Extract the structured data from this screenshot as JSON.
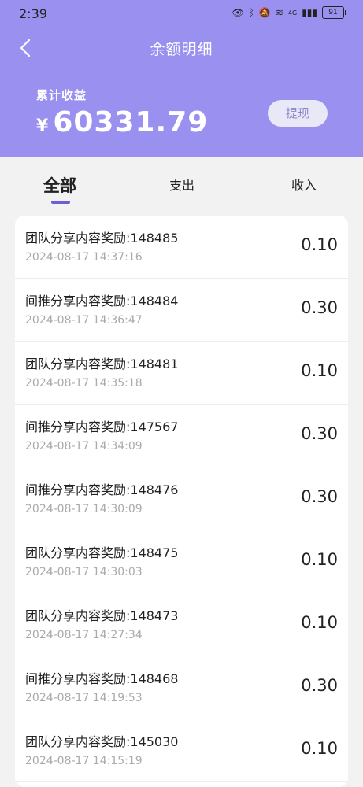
{
  "status": {
    "time": "2:39",
    "battery": "91",
    "network": "4G"
  },
  "header": {
    "title": "余额明细"
  },
  "summary": {
    "label": "累计收益",
    "currency": "¥",
    "value": "60331.79",
    "withdraw_label": "提现"
  },
  "tabs": [
    {
      "label": "全部",
      "active": true
    },
    {
      "label": "支出",
      "active": false
    },
    {
      "label": "收入",
      "active": false
    }
  ],
  "records": [
    {
      "title": "团队分享内容奖励:148485",
      "time": "2024-08-17 14:37:16",
      "amount": "0.10"
    },
    {
      "title": "间推分享内容奖励:148484",
      "time": "2024-08-17 14:36:47",
      "amount": "0.30"
    },
    {
      "title": "团队分享内容奖励:148481",
      "time": "2024-08-17 14:35:18",
      "amount": "0.10"
    },
    {
      "title": "间推分享内容奖励:147567",
      "time": "2024-08-17 14:34:09",
      "amount": "0.30"
    },
    {
      "title": "间推分享内容奖励:148476",
      "time": "2024-08-17 14:30:09",
      "amount": "0.30"
    },
    {
      "title": "团队分享内容奖励:148475",
      "time": "2024-08-17 14:30:03",
      "amount": "0.10"
    },
    {
      "title": "团队分享内容奖励:148473",
      "time": "2024-08-17 14:27:34",
      "amount": "0.10"
    },
    {
      "title": "间推分享内容奖励:148468",
      "time": "2024-08-17 14:19:53",
      "amount": "0.30"
    },
    {
      "title": "团队分享内容奖励:145030",
      "time": "2024-08-17 14:15:19",
      "amount": "0.10"
    }
  ]
}
